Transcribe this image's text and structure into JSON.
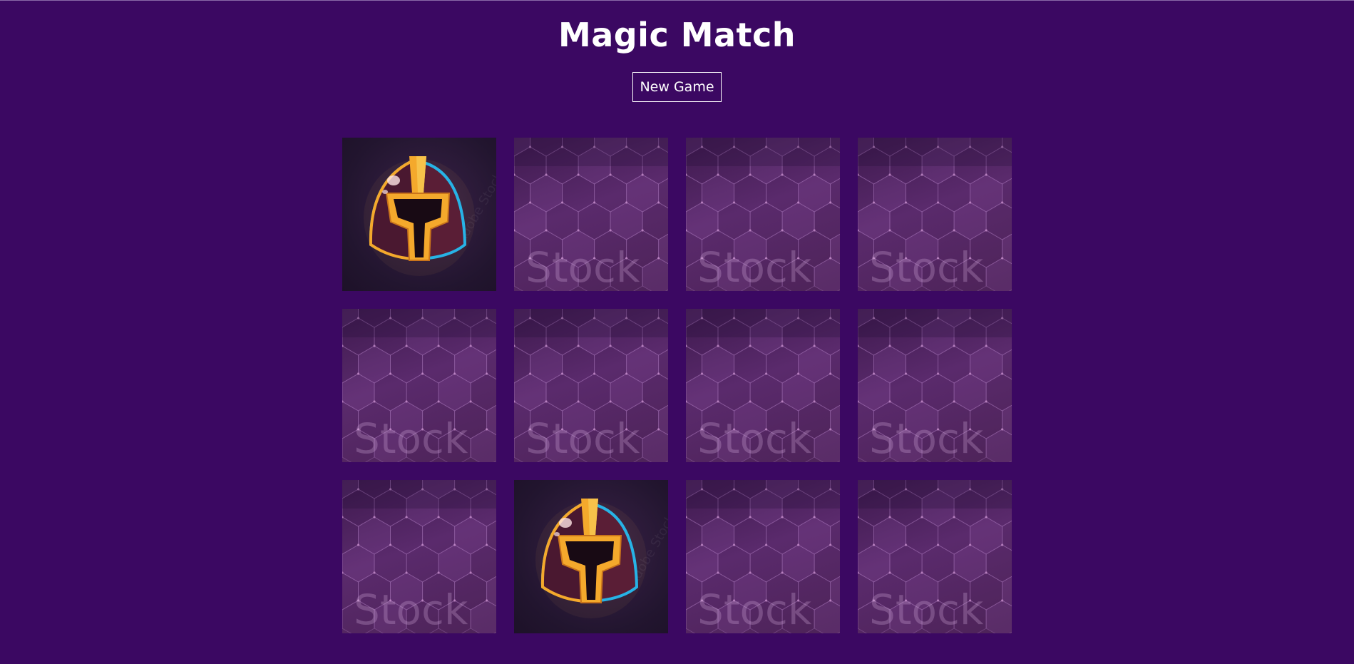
{
  "game": {
    "title": "Magic Match",
    "new_game_label": "New Game",
    "back_watermark": "Stock",
    "face_watermark": "Adobe Stock",
    "cards": [
      {
        "state": "face-up",
        "image": "helmet"
      },
      {
        "state": "face-down",
        "image": ""
      },
      {
        "state": "face-down",
        "image": ""
      },
      {
        "state": "face-down",
        "image": ""
      },
      {
        "state": "face-down",
        "image": ""
      },
      {
        "state": "face-down",
        "image": ""
      },
      {
        "state": "face-down",
        "image": ""
      },
      {
        "state": "face-down",
        "image": ""
      },
      {
        "state": "face-down",
        "image": ""
      },
      {
        "state": "face-up",
        "image": "helmet"
      },
      {
        "state": "face-down",
        "image": ""
      },
      {
        "state": "face-down",
        "image": ""
      }
    ]
  },
  "colors": {
    "background": "#3b0862",
    "card_back": "#4d2358",
    "helmet_gold": "#f4a92c",
    "helmet_blue": "#27b3e6",
    "helmet_maroon": "#5a1e36"
  }
}
